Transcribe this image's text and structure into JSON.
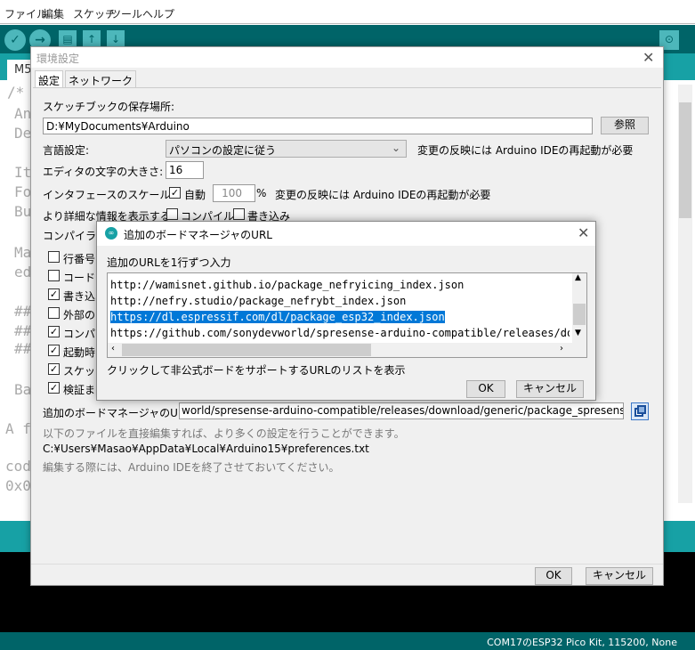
{
  "menu": [
    "ファイル",
    "編集",
    "スケッチ",
    "ツール",
    "ヘルプ"
  ],
  "toolbar": {
    "verify": "✓",
    "upload": "→",
    "new": "▤",
    "open": "↑",
    "save": "↓",
    "serial": "⊙"
  },
  "sketch_tab": "M5",
  "code_lines": [
    "/*",
    "An",
    "De",
    "It",
    "Fo",
    "Bu",
    "Ma",
    "ed",
    "##",
    "##",
    "##",
    "Ba",
    "A f",
    "cod",
    "0x0"
  ],
  "status": "COM17のESP32 Pico Kit, 115200, None",
  "prefs": {
    "title": "環境設定",
    "tabs": [
      "設定",
      "ネットワーク"
    ],
    "sketchbook_label": "スケッチブックの保存場所:",
    "sketchbook_path": "D:¥MyDocuments¥Arduino",
    "browse": "参照",
    "language_label": "言語設定:",
    "language_value": "パソコンの設定に従う",
    "restart_note": "変更の反映には Arduino IDEの再起動が必要",
    "font_size_label": "エディタの文字の大きさ:",
    "font_size": "16",
    "scale_label": "インタフェースのスケール:",
    "scale_auto": "自動",
    "scale_value": "100",
    "scale_unit": "%",
    "verbose_label": "より詳細な情報を表示する:",
    "verbose_compile": "コンパイル",
    "verbose_upload": "書き込み",
    "warnings_label": "コンパイラの警",
    "checkboxes": [
      {
        "label": "行番号を",
        "checked": false
      },
      {
        "label": "コードの",
        "checked": false
      },
      {
        "label": "書き込み",
        "checked": true
      },
      {
        "label": "外部のエ",
        "checked": false
      },
      {
        "label": "コンパイル",
        "checked": true
      },
      {
        "label": "起動時(",
        "checked": true
      },
      {
        "label": "スケッチを",
        "checked": true
      },
      {
        "label": "検証また",
        "checked": true
      }
    ],
    "board_urls_label": "追加のボードマネージャのURL:",
    "board_urls_value": "world/spresense-arduino-compatible/releases/download/generic/package_spresense_index.json",
    "edit_note": "以下のファイルを直接編集すれば、より多くの設定を行うことができます。",
    "prefs_path": "C:¥Users¥Masao¥AppData¥Local¥Arduino15¥preferences.txt",
    "close_note": "編集する際には、Arduino IDEを終了させておいてください。",
    "ok": "OK",
    "cancel": "キャンセル"
  },
  "url_dialog": {
    "title": "追加のボードマネージャのURL",
    "instruction": "追加のURLを1行ずつ入力",
    "urls": [
      "http://wamisnet.github.io/package_nefryicing_index.json",
      "http://nefry.studio/package_nefrybt_index.json",
      "https://dl.espressif.com/dl/package_esp32_index.json",
      "https://github.com/sonydevworld/spresense-arduino-compatible/releases/down"
    ],
    "link": "クリックして非公式ボードをサポートするURLのリストを表示",
    "ok": "OK",
    "cancel": "キャンセル"
  },
  "colors": {
    "teal_dark": "#006468",
    "teal": "#17a1a5",
    "selection": "#0078d7"
  }
}
